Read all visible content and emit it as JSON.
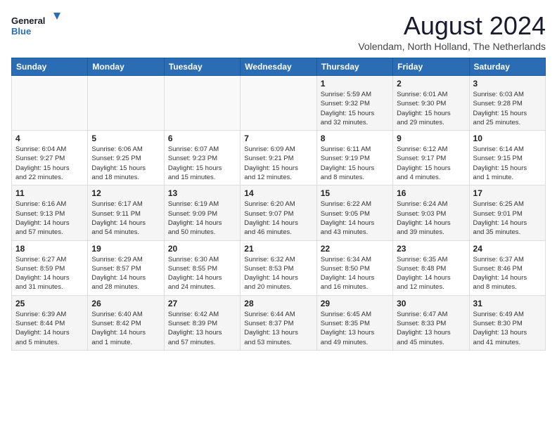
{
  "logo": {
    "line1": "General",
    "line2": "Blue"
  },
  "title": "August 2024",
  "location": "Volendam, North Holland, The Netherlands",
  "days_header": [
    "Sunday",
    "Monday",
    "Tuesday",
    "Wednesday",
    "Thursday",
    "Friday",
    "Saturday"
  ],
  "weeks": [
    [
      {
        "day": "",
        "data": ""
      },
      {
        "day": "",
        "data": ""
      },
      {
        "day": "",
        "data": ""
      },
      {
        "day": "",
        "data": ""
      },
      {
        "day": "1",
        "data": "Sunrise: 5:59 AM\nSunset: 9:32 PM\nDaylight: 15 hours\nand 32 minutes."
      },
      {
        "day": "2",
        "data": "Sunrise: 6:01 AM\nSunset: 9:30 PM\nDaylight: 15 hours\nand 29 minutes."
      },
      {
        "day": "3",
        "data": "Sunrise: 6:03 AM\nSunset: 9:28 PM\nDaylight: 15 hours\nand 25 minutes."
      }
    ],
    [
      {
        "day": "4",
        "data": "Sunrise: 6:04 AM\nSunset: 9:27 PM\nDaylight: 15 hours\nand 22 minutes."
      },
      {
        "day": "5",
        "data": "Sunrise: 6:06 AM\nSunset: 9:25 PM\nDaylight: 15 hours\nand 18 minutes."
      },
      {
        "day": "6",
        "data": "Sunrise: 6:07 AM\nSunset: 9:23 PM\nDaylight: 15 hours\nand 15 minutes."
      },
      {
        "day": "7",
        "data": "Sunrise: 6:09 AM\nSunset: 9:21 PM\nDaylight: 15 hours\nand 12 minutes."
      },
      {
        "day": "8",
        "data": "Sunrise: 6:11 AM\nSunset: 9:19 PM\nDaylight: 15 hours\nand 8 minutes."
      },
      {
        "day": "9",
        "data": "Sunrise: 6:12 AM\nSunset: 9:17 PM\nDaylight: 15 hours\nand 4 minutes."
      },
      {
        "day": "10",
        "data": "Sunrise: 6:14 AM\nSunset: 9:15 PM\nDaylight: 15 hours\nand 1 minute."
      }
    ],
    [
      {
        "day": "11",
        "data": "Sunrise: 6:16 AM\nSunset: 9:13 PM\nDaylight: 14 hours\nand 57 minutes."
      },
      {
        "day": "12",
        "data": "Sunrise: 6:17 AM\nSunset: 9:11 PM\nDaylight: 14 hours\nand 54 minutes."
      },
      {
        "day": "13",
        "data": "Sunrise: 6:19 AM\nSunset: 9:09 PM\nDaylight: 14 hours\nand 50 minutes."
      },
      {
        "day": "14",
        "data": "Sunrise: 6:20 AM\nSunset: 9:07 PM\nDaylight: 14 hours\nand 46 minutes."
      },
      {
        "day": "15",
        "data": "Sunrise: 6:22 AM\nSunset: 9:05 PM\nDaylight: 14 hours\nand 43 minutes."
      },
      {
        "day": "16",
        "data": "Sunrise: 6:24 AM\nSunset: 9:03 PM\nDaylight: 14 hours\nand 39 minutes."
      },
      {
        "day": "17",
        "data": "Sunrise: 6:25 AM\nSunset: 9:01 PM\nDaylight: 14 hours\nand 35 minutes."
      }
    ],
    [
      {
        "day": "18",
        "data": "Sunrise: 6:27 AM\nSunset: 8:59 PM\nDaylight: 14 hours\nand 31 minutes."
      },
      {
        "day": "19",
        "data": "Sunrise: 6:29 AM\nSunset: 8:57 PM\nDaylight: 14 hours\nand 28 minutes."
      },
      {
        "day": "20",
        "data": "Sunrise: 6:30 AM\nSunset: 8:55 PM\nDaylight: 14 hours\nand 24 minutes."
      },
      {
        "day": "21",
        "data": "Sunrise: 6:32 AM\nSunset: 8:53 PM\nDaylight: 14 hours\nand 20 minutes."
      },
      {
        "day": "22",
        "data": "Sunrise: 6:34 AM\nSunset: 8:50 PM\nDaylight: 14 hours\nand 16 minutes."
      },
      {
        "day": "23",
        "data": "Sunrise: 6:35 AM\nSunset: 8:48 PM\nDaylight: 14 hours\nand 12 minutes."
      },
      {
        "day": "24",
        "data": "Sunrise: 6:37 AM\nSunset: 8:46 PM\nDaylight: 14 hours\nand 8 minutes."
      }
    ],
    [
      {
        "day": "25",
        "data": "Sunrise: 6:39 AM\nSunset: 8:44 PM\nDaylight: 14 hours\nand 5 minutes."
      },
      {
        "day": "26",
        "data": "Sunrise: 6:40 AM\nSunset: 8:42 PM\nDaylight: 14 hours\nand 1 minute."
      },
      {
        "day": "27",
        "data": "Sunrise: 6:42 AM\nSunset: 8:39 PM\nDaylight: 13 hours\nand 57 minutes."
      },
      {
        "day": "28",
        "data": "Sunrise: 6:44 AM\nSunset: 8:37 PM\nDaylight: 13 hours\nand 53 minutes."
      },
      {
        "day": "29",
        "data": "Sunrise: 6:45 AM\nSunset: 8:35 PM\nDaylight: 13 hours\nand 49 minutes."
      },
      {
        "day": "30",
        "data": "Sunrise: 6:47 AM\nSunset: 8:33 PM\nDaylight: 13 hours\nand 45 minutes."
      },
      {
        "day": "31",
        "data": "Sunrise: 6:49 AM\nSunset: 8:30 PM\nDaylight: 13 hours\nand 41 minutes."
      }
    ]
  ]
}
